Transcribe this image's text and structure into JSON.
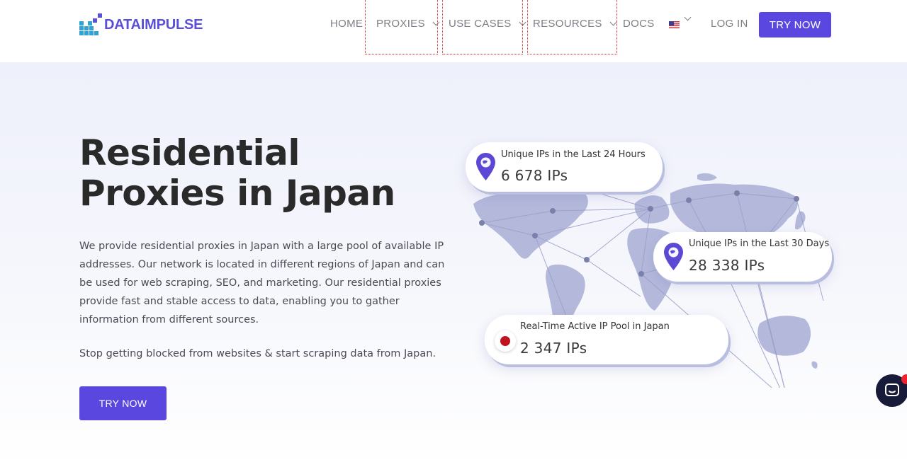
{
  "brand": {
    "name": "DATAIMPULSE",
    "color": "#5a4fd9"
  },
  "nav": {
    "home": "HOME",
    "proxies": "PROXIES",
    "use_cases": "USE CASES",
    "resources": "RESOURCES",
    "docs": "DOCS",
    "language_icon": "us-flag-icon",
    "login": "LOG IN",
    "try_now": "TRY NOW"
  },
  "hero": {
    "title": "Residential Proxies in Japan",
    "description": "We provide residential proxies in Japan with a large pool of available IP addresses. Our network is located in different regions of Japan and can be used for web scraping, SEO, and marketing. Our residential proxies provide fast and stable access to data, enabling you to gather information from different sources.",
    "subtext": "Stop getting blocked from websites & start scraping data from Japan.",
    "cta": "TRY NOW"
  },
  "stats": [
    {
      "label": "Unique IPs in the Last 24 Hours",
      "value": "6 678 IPs",
      "icon": "location-pin-icon"
    },
    {
      "label": "Unique IPs in the Last 30 Days",
      "value": "28 338 IPs",
      "icon": "location-pin-icon"
    },
    {
      "label": "Real-Time Active IP Pool in Japan",
      "value": "2 347 IPs",
      "icon": "japan-flag-icon"
    }
  ],
  "colors": {
    "accent": "#5a47e0",
    "map": "#b4b9dc",
    "chat": "#181a3a"
  }
}
